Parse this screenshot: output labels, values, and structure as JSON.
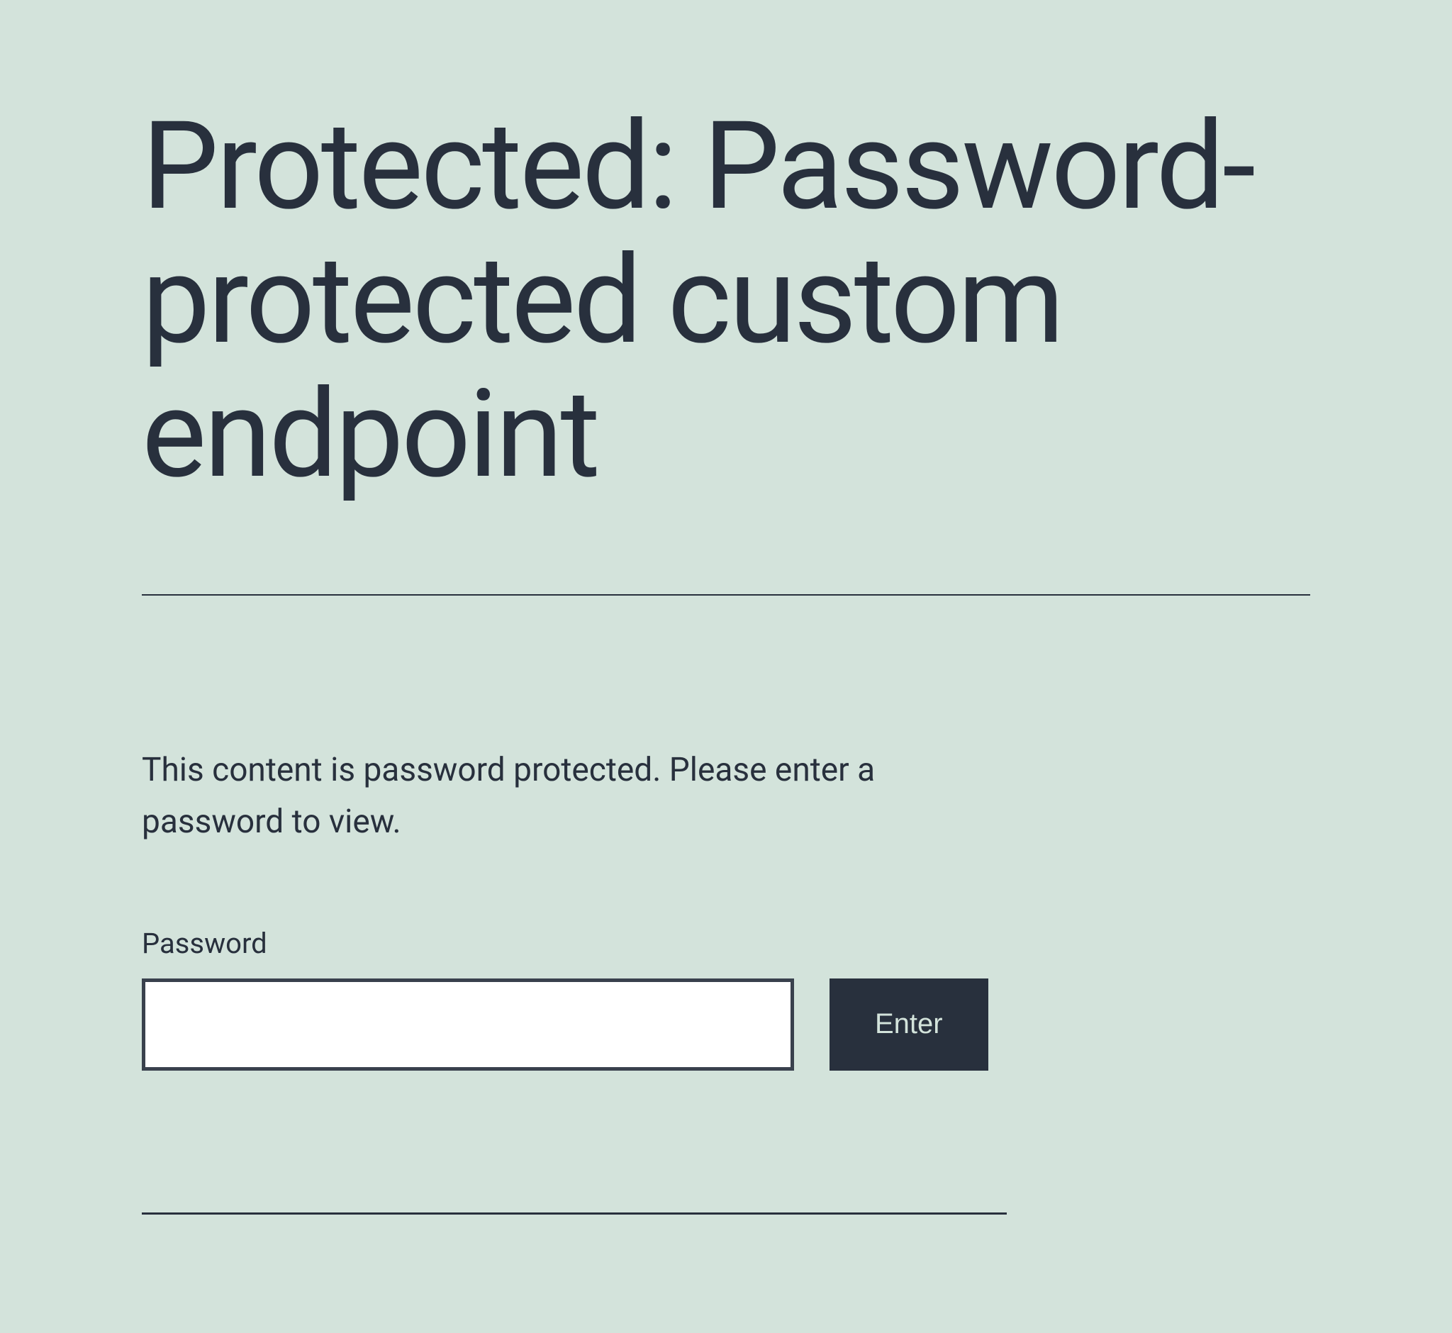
{
  "header": {
    "title": "Protected: Password-protected custom endpoint"
  },
  "content": {
    "instruction": "This content is password protected. Please enter a password to view.",
    "form": {
      "password_label": "Password",
      "password_value": "",
      "submit_label": "Enter"
    }
  }
}
